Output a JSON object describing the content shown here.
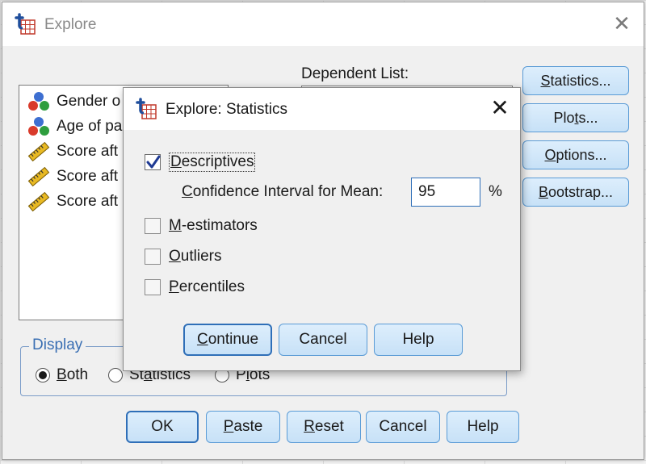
{
  "main_dialog": {
    "title": "Explore",
    "dependent_list_label": "Dependent List:",
    "variables": [
      {
        "label": "Gender o",
        "icon": "nominal-variable-icon"
      },
      {
        "label": "Age of pa",
        "icon": "nominal-variable-icon"
      },
      {
        "label": "Score aft",
        "icon": "scale-variable-icon"
      },
      {
        "label": "Score aft",
        "icon": "scale-variable-icon"
      },
      {
        "label": "Score aft",
        "icon": "scale-variable-icon"
      }
    ],
    "side_buttons": {
      "statistics": {
        "mnemonic": "S",
        "rest": "tatistics..."
      },
      "plots": {
        "before": "Plo",
        "mnemonic": "t",
        "after": "s..."
      },
      "options": {
        "mnemonic": "O",
        "rest": "ptions..."
      },
      "bootstrap": {
        "mnemonic": "B",
        "rest": "ootstrap..."
      }
    },
    "display": {
      "legend": "Display",
      "options": [
        {
          "mnemonic": "B",
          "rest": "oth",
          "selected": true
        },
        {
          "before": "St",
          "mnemonic": "a",
          "after": "tistics",
          "selected": false
        },
        {
          "before": "P",
          "mnemonic": "l",
          "after": "ots",
          "selected": false
        }
      ]
    },
    "buttons": {
      "ok": "OK",
      "paste": {
        "mnemonic": "P",
        "rest": "aste"
      },
      "reset": {
        "mnemonic": "R",
        "rest": "eset"
      },
      "cancel": "Cancel",
      "help": "Help"
    }
  },
  "stats_dialog": {
    "title": "Explore: Statistics",
    "descriptives": {
      "mnemonic": "D",
      "rest": "escriptives",
      "checked": true
    },
    "confidence_interval": {
      "mnemonic": "C",
      "rest": "onfidence Interval for Mean:",
      "value": "95",
      "unit": "%"
    },
    "m_estimators": {
      "mnemonic": "M",
      "rest": "-estimators",
      "checked": false
    },
    "outliers": {
      "mnemonic": "O",
      "rest": "utliers",
      "checked": false
    },
    "percentiles": {
      "mnemonic": "P",
      "rest": "ercentiles",
      "checked": false
    },
    "buttons": {
      "continue": {
        "mnemonic": "C",
        "rest": "ontinue"
      },
      "cancel": "Cancel",
      "help": "Help"
    }
  },
  "colors": {
    "button_border": "#5a9bd6",
    "button_fill": "#c7e1f7",
    "group_label": "#3a6fb3",
    "check_mark": "#1f3a93"
  }
}
